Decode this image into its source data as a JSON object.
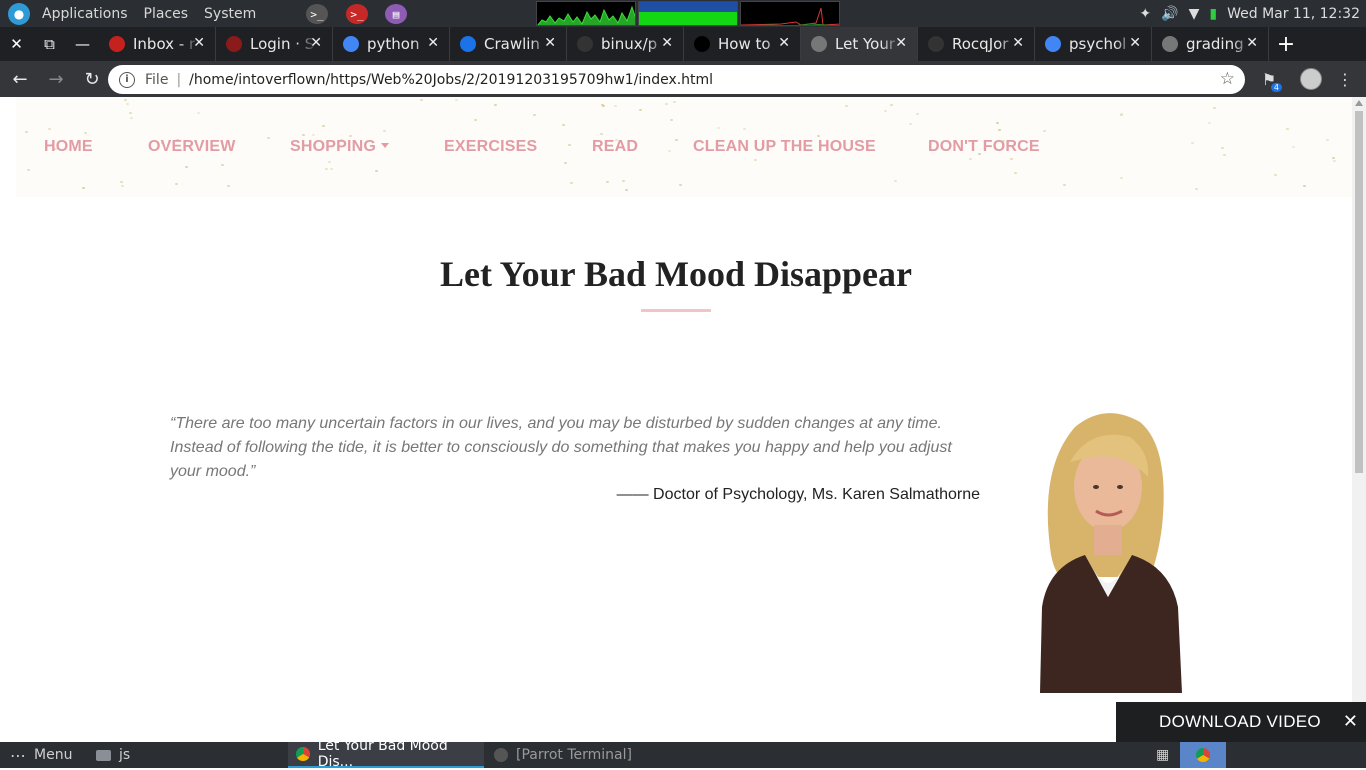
{
  "system_panel": {
    "menus": [
      "Applications",
      "Places",
      "System"
    ],
    "clock": "Wed Mar 11, 12:32"
  },
  "tabs": [
    {
      "title": "Inbox - r",
      "favicon": "gmail-icon",
      "color": "#c5221f"
    },
    {
      "title": "Login · S",
      "favicon": "login-icon",
      "color": "#8b1a1a"
    },
    {
      "title": "python",
      "favicon": "google-icon",
      "color": "#4285f4"
    },
    {
      "title": "Crawlin",
      "favicon": "crawler-icon",
      "color": "#1a73e8"
    },
    {
      "title": "binux/p",
      "favicon": "github-icon",
      "color": "#333333"
    },
    {
      "title": "How to",
      "favicon": "dev-icon",
      "color": "#000000"
    },
    {
      "title": "Let Your",
      "favicon": "globe-icon",
      "color": "#777777",
      "active": true
    },
    {
      "title": "RocqJor",
      "favicon": "github-icon",
      "color": "#333333"
    },
    {
      "title": "psychol",
      "favicon": "google-icon",
      "color": "#4285f4"
    },
    {
      "title": "grading",
      "favicon": "globe-icon",
      "color": "#777777"
    }
  ],
  "address_bar": {
    "scheme_label": "File",
    "url": "/home/intoverflown/https/Web%20Jobs/2/20191203195709hw1/index.html",
    "extension_badge": "4"
  },
  "site": {
    "nav": [
      {
        "label": "HOME"
      },
      {
        "label": "OVERVIEW"
      },
      {
        "label": "SHOPPING",
        "dropdown": true
      },
      {
        "label": "EXERCISES"
      },
      {
        "label": "READ"
      },
      {
        "label": "CLEAN UP THE HOUSE"
      },
      {
        "label": "DON'T FORCE"
      }
    ],
    "accent_color": "#e39ba4",
    "headline": "Let Your Bad Mood Disappear",
    "quote": "“There are too many uncertain factors in our lives, and you may be disturbed by sudden changes at any time. Instead of following the tide, it is better to consciously do something that makes you happy and help you adjust your mood.”",
    "attribution": "—— Doctor of Psychology, Ms. Karen Salmathorne"
  },
  "download_bar": {
    "label": "DOWNLOAD VIDEO"
  },
  "bottom_panel": {
    "menu_label": "Menu",
    "folder_label": "js",
    "tasks": [
      {
        "label": "Let Your Bad Mood Dis...",
        "active": true
      },
      {
        "label": "[Parrot Terminal]",
        "active": false
      }
    ]
  }
}
